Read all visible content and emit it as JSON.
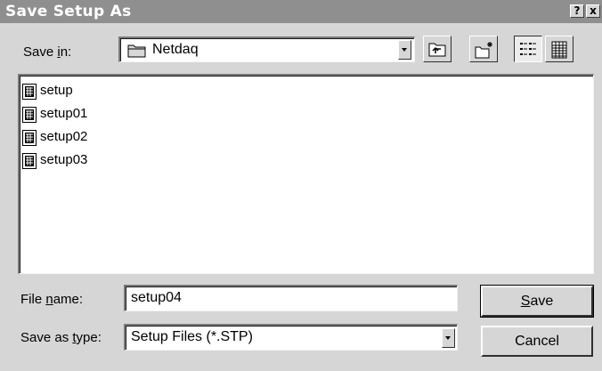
{
  "window": {
    "title": "Save Setup As",
    "help_button": "?",
    "close_button": "x"
  },
  "save_in": {
    "label_before": "Save ",
    "label_accel": "i",
    "label_after": "n:",
    "value": "Netdaq"
  },
  "files": [
    {
      "name": "setup"
    },
    {
      "name": "setup01"
    },
    {
      "name": "setup02"
    },
    {
      "name": "setup03"
    }
  ],
  "file_name": {
    "label_before": "File ",
    "label_accel": "n",
    "label_after": "ame:",
    "value": "setup04"
  },
  "save_type": {
    "label_before": "Save as ",
    "label_accel": "t",
    "label_after": "ype:",
    "value": "Setup Files (*.STP)"
  },
  "buttons": {
    "save_accel": "S",
    "save_rest": "ave",
    "cancel": "Cancel"
  },
  "colors": {
    "titlebar": "#8f8f8f",
    "face": "#d6d6d6",
    "window": "#ffffff"
  }
}
